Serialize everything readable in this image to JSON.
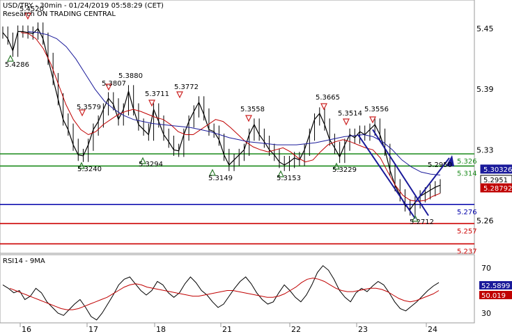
{
  "header": {
    "title": "USD/TRY - 30min - 01/24/2019 05:58:29 (CET)",
    "subtitle": "Research ON TRADING CENTRAL"
  },
  "colors": {
    "price": "#000000",
    "ma_fast": "#c00000",
    "ma_slow": "#1a1a9a",
    "resistance": "#1a8a1a",
    "pivot": "#0000aa",
    "support": "#cc0000",
    "rsi": "#000000",
    "rsi_ma": "#c00000",
    "marker_up": "#2d7a2d",
    "marker_down": "#cc2222",
    "tag_blue": "#1a1a9a",
    "tag_red": "#c00000"
  },
  "chart_data": [
    {
      "type": "line",
      "panel": "price",
      "ylim": [
        5.225,
        5.475
      ],
      "yticks": [
        5.45,
        5.39,
        5.33,
        5.26
      ],
      "x_dates": [
        "16",
        "17",
        "18",
        "21",
        "22",
        "23",
        "24"
      ],
      "series": [
        {
          "role": "close",
          "values": [
            5.446,
            5.44,
            5.428,
            5.447,
            5.447,
            5.446,
            5.445,
            5.45,
            5.44,
            5.42,
            5.4,
            5.38,
            5.36,
            5.35,
            5.335,
            5.325,
            5.324,
            5.335,
            5.35,
            5.358,
            5.37,
            5.381,
            5.375,
            5.36,
            5.37,
            5.388,
            5.37,
            5.355,
            5.35,
            5.345,
            5.37,
            5.358,
            5.345,
            5.338,
            5.33,
            5.329,
            5.345,
            5.358,
            5.368,
            5.377,
            5.365,
            5.35,
            5.348,
            5.34,
            5.325,
            5.315,
            5.32,
            5.325,
            5.33,
            5.345,
            5.355,
            5.345,
            5.338,
            5.33,
            5.325,
            5.318,
            5.315,
            5.318,
            5.322,
            5.32,
            5.33,
            5.345,
            5.36,
            5.366,
            5.355,
            5.34,
            5.332,
            5.323,
            5.335,
            5.345,
            5.342,
            5.348,
            5.345,
            5.35,
            5.355,
            5.345,
            5.33,
            5.31,
            5.295,
            5.285,
            5.275,
            5.271,
            5.278,
            5.284,
            5.287,
            5.29,
            5.293,
            5.295
          ]
        },
        {
          "role": "moving average (red)",
          "values": [
            5.446,
            5.445,
            5.44,
            5.43,
            5.415,
            5.395,
            5.375,
            5.36,
            5.35,
            5.345,
            5.348,
            5.355,
            5.36,
            5.365,
            5.368,
            5.37,
            5.368,
            5.365,
            5.362,
            5.36,
            5.355,
            5.348,
            5.345,
            5.345,
            5.35,
            5.355,
            5.36,
            5.358,
            5.352,
            5.345,
            5.338,
            5.333,
            5.33,
            5.328,
            5.33,
            5.332,
            5.328,
            5.322,
            5.318,
            5.32,
            5.328,
            5.335,
            5.338,
            5.34,
            5.338,
            5.335,
            5.332,
            5.33,
            5.322,
            5.308,
            5.295,
            5.285,
            5.28,
            5.279,
            5.28,
            5.284,
            5.287
          ]
        },
        {
          "role": "moving average (blue)",
          "values": [
            5.447,
            5.446,
            5.444,
            5.44,
            5.432,
            5.42,
            5.405,
            5.39,
            5.378,
            5.37,
            5.364,
            5.36,
            5.358,
            5.356,
            5.355,
            5.354,
            5.353,
            5.352,
            5.35,
            5.348,
            5.345,
            5.342,
            5.34,
            5.338,
            5.337,
            5.336,
            5.335,
            5.335,
            5.335,
            5.336,
            5.337,
            5.339,
            5.341,
            5.343,
            5.344,
            5.345,
            5.343,
            5.338,
            5.33,
            5.32,
            5.313,
            5.308,
            5.306,
            5.305
          ]
        }
      ],
      "levels": [
        {
          "value": 5.326,
          "label": "5.326",
          "kind": "resistance"
        },
        {
          "value": 5.314,
          "label": "5.314",
          "kind": "resistance"
        },
        {
          "value": 5.276,
          "label": "5.276",
          "kind": "pivot"
        },
        {
          "value": 5.257,
          "label": "5.257",
          "kind": "support"
        },
        {
          "value": 5.237,
          "label": "5.237",
          "kind": "support"
        }
      ],
      "price_tags": [
        {
          "value": 5.30326,
          "label": "5.30326",
          "style": "blue"
        },
        {
          "value": 5.2951,
          "label": "5.2951",
          "style": "black"
        },
        {
          "value": 5.28792,
          "label": "5.28792",
          "style": "red"
        }
      ],
      "annotations": [
        {
          "label": "5.4520",
          "marker": "down"
        },
        {
          "label": "5.4286",
          "marker": "up"
        },
        {
          "label": "5.3579",
          "marker": "down"
        },
        {
          "label": "5.3240",
          "marker": "up"
        },
        {
          "label": "5.3807",
          "marker": "down"
        },
        {
          "label": "5.3880",
          "marker": "none"
        },
        {
          "label": "5.3711",
          "marker": "down"
        },
        {
          "label": "5.3294",
          "marker": "up"
        },
        {
          "label": "5.3772",
          "marker": "down"
        },
        {
          "label": "5.3149",
          "marker": "up"
        },
        {
          "label": "5.3558",
          "marker": "down"
        },
        {
          "label": "5.3153",
          "marker": "up"
        },
        {
          "label": "5.3665",
          "marker": "down"
        },
        {
          "label": "5.3229",
          "marker": "up"
        },
        {
          "label": "5.3514",
          "marker": "down"
        },
        {
          "label": "5.3556",
          "marker": "down"
        },
        {
          "label": "5.2712",
          "marker": "up"
        },
        {
          "label": "5.2950",
          "marker": "none"
        }
      ]
    },
    {
      "type": "line",
      "panel": "rsi",
      "title": "RSI14 - 9MA",
      "ylim": [
        20,
        80
      ],
      "yticks": [
        70,
        30
      ],
      "series": [
        {
          "role": "RSI14",
          "values": [
            55,
            52,
            48,
            50,
            42,
            45,
            52,
            48,
            40,
            35,
            30,
            28,
            33,
            38,
            42,
            35,
            27,
            24,
            30,
            38,
            46,
            55,
            60,
            62,
            56,
            50,
            46,
            50,
            58,
            55,
            48,
            44,
            48,
            56,
            62,
            57,
            50,
            46,
            40,
            35,
            38,
            45,
            52,
            58,
            62,
            56,
            48,
            42,
            38,
            40,
            48,
            55,
            50,
            44,
            40,
            46,
            55,
            66,
            72,
            68,
            60,
            50,
            44,
            40,
            48,
            52,
            49,
            54,
            58,
            55,
            48,
            40,
            34,
            32,
            36,
            40,
            45,
            50,
            54,
            57
          ]
        },
        {
          "role": "9MA",
          "values": [
            52,
            50,
            48,
            46,
            44,
            42,
            40,
            38,
            36,
            34,
            33,
            33,
            34,
            36,
            38,
            40,
            42,
            44,
            47,
            50,
            53,
            55,
            56,
            55,
            53,
            52,
            51,
            50,
            49,
            48,
            47,
            46,
            45,
            45,
            46,
            47,
            48,
            49,
            50,
            50,
            49,
            48,
            47,
            46,
            45,
            44,
            44,
            45,
            47,
            50,
            53,
            57,
            60,
            61,
            60,
            58,
            55,
            52,
            50,
            49,
            49,
            50,
            51,
            52,
            52,
            51,
            49,
            46,
            43,
            41,
            40,
            41,
            43,
            45,
            47,
            50
          ]
        }
      ],
      "price_tags": [
        {
          "value": 52.5899,
          "label": "52.5899",
          "style": "blue"
        },
        {
          "value": 50.019,
          "label": "50.019",
          "style": "red"
        }
      ]
    }
  ]
}
